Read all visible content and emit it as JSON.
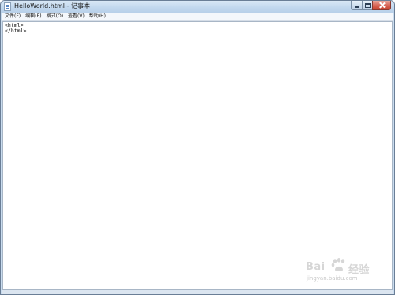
{
  "window": {
    "title": "HelloWorld.html - 记事本"
  },
  "menu": {
    "items": [
      {
        "label": "文件(F)"
      },
      {
        "label": "编辑(E)"
      },
      {
        "label": "格式(O)"
      },
      {
        "label": "查看(V)"
      },
      {
        "label": "帮助(H)"
      }
    ]
  },
  "editor": {
    "content": "<html>\n</html>"
  },
  "watermark": {
    "brand_left": "Bai",
    "brand_right": "经验",
    "subtitle": "jingyan.baidu.com"
  },
  "icons": {
    "app": "notepad-icon",
    "minimize": "minimize-icon",
    "maximize": "maximize-icon",
    "close": "close-icon",
    "watermark": "paw-logo-icon"
  },
  "colors": {
    "titlebar": "#c2d8ee",
    "close_button": "#d8685a",
    "editor_background": "#ffffff"
  }
}
